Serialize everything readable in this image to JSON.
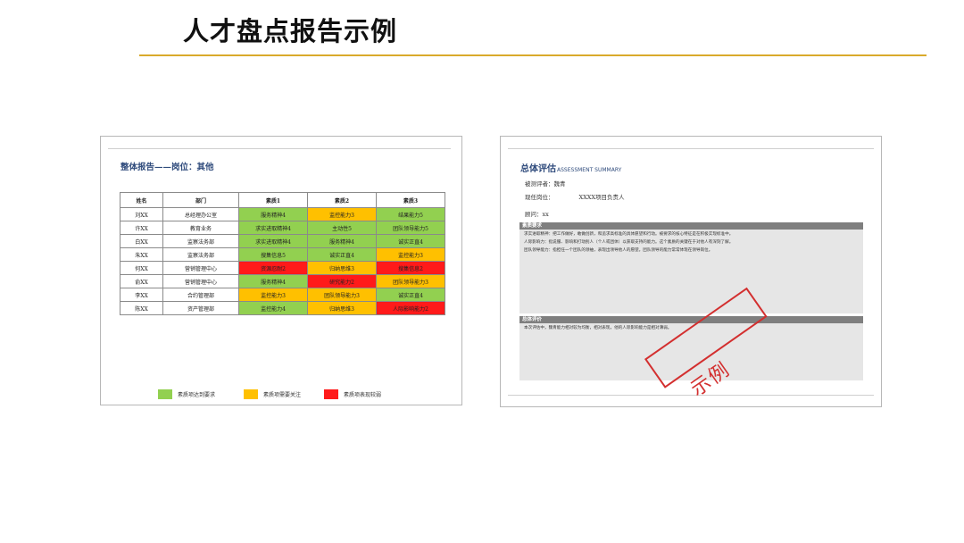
{
  "slide": {
    "title": "人才盘点报告示例"
  },
  "left_panel": {
    "report_title": "整体报告——岗位：其他",
    "table": {
      "headers": [
        "姓名",
        "部门",
        "素质1",
        "素质2",
        "素质3"
      ],
      "rows": [
        {
          "cells": [
            "刘XX",
            "总经理办公室",
            "服务精神4",
            "监控能力3",
            "结果能力5"
          ],
          "colors": [
            "plain",
            "plain",
            "g",
            "y",
            "g"
          ]
        },
        {
          "cells": [
            "许XX",
            "教育业务",
            "求实进取精神4",
            "主动性5",
            "团队领导能力5"
          ],
          "colors": [
            "plain",
            "plain",
            "g",
            "g",
            "g"
          ]
        },
        {
          "cells": [
            "白XX",
            "监察法务部",
            "求实进取精神4",
            "服务精神4",
            "诚实正直4"
          ],
          "colors": [
            "plain",
            "plain",
            "g",
            "g",
            "g"
          ]
        },
        {
          "cells": [
            "朱XX",
            "监察法务部",
            "搜集信息5",
            "诚实正直4",
            "监控能力3"
          ],
          "colors": [
            "plain",
            "plain",
            "g",
            "g",
            "y"
          ]
        },
        {
          "cells": [
            "何XX",
            "营销管理中心",
            "资源忍耐2",
            "归纳思维3",
            "搜集信息2"
          ],
          "colors": [
            "plain",
            "plain",
            "r",
            "y",
            "r"
          ]
        },
        {
          "cells": [
            "俞XX",
            "营销管理中心",
            "服务精神4",
            "研究能力2",
            "团队领导能力3"
          ],
          "colors": [
            "plain",
            "plain",
            "g",
            "r",
            "y"
          ]
        },
        {
          "cells": [
            "李XX",
            "合约管理部",
            "监控能力3",
            "团队领导能力3",
            "诚实正直4"
          ],
          "colors": [
            "plain",
            "plain",
            "y",
            "y",
            "g"
          ]
        },
        {
          "cells": [
            "陈XX",
            "资产管理部",
            "监控能力4",
            "归纳思维3",
            "人际影响能力2"
          ],
          "colors": [
            "plain",
            "plain",
            "g",
            "y",
            "r"
          ]
        }
      ]
    },
    "legend": [
      {
        "label": "素质项达到要求",
        "color": "#92d050"
      },
      {
        "label": "素质项需要关注",
        "color": "#ffc000"
      },
      {
        "label": "素质项表现较弱",
        "color": "#ff1a1a"
      }
    ]
  },
  "right_panel": {
    "title_cn": "总体评估",
    "title_en": "ASSESSMENT SUMMARY",
    "assessee_label": "被测评者：魏青",
    "position_label": "现任岗位：",
    "position_value": "XXXX项目负责人",
    "advisor_label": "顾问：xx",
    "section1_title": "素质要求",
    "section1_paragraphs": [
      "求实进取精神：把工作做好，敢做创新，和追求高标准的具体愿望和行动。被要求的核心特征是在积极实现标准中。",
      "人际影响力：指说服、影响和打动别人（个人或团体）以获取支持的能力。这个素质的关键在于对他人有深刻了解。",
      "团队领导能力：指担任一个团队的领袖，表现出领导他人的愿望。团队领导的能力常常体现在领导岗位。"
    ],
    "section2_title": "总体评价",
    "section2_text": "本次评估中，魏青能力相对较为均衡，相对表现，他的人际影响能力是相对薄弱。"
  },
  "stamp": {
    "text": "示例",
    "color": "#d32f2f"
  }
}
